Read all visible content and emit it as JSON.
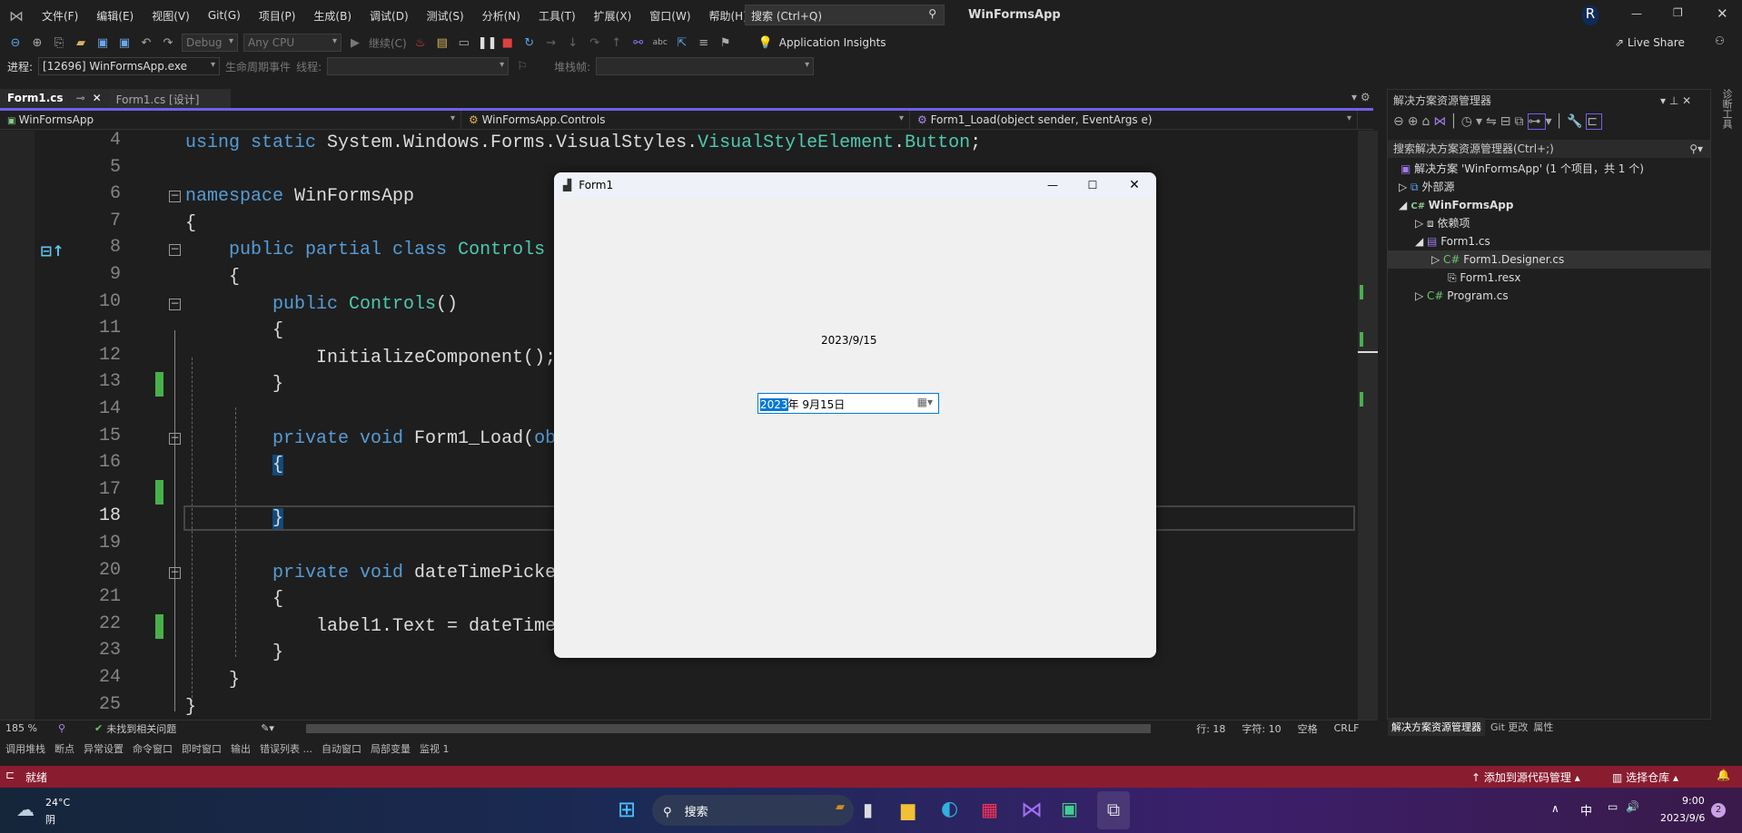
{
  "menu": {
    "items": [
      "文件(F)",
      "编辑(E)",
      "视图(V)",
      "Git(G)",
      "项目(P)",
      "生成(B)",
      "调试(D)",
      "测试(S)",
      "分析(N)",
      "工具(T)",
      "扩展(X)",
      "窗口(W)",
      "帮助(H)"
    ],
    "search": "搜索 (Ctrl+Q)",
    "solution_title": "WinFormsApp",
    "avatar": "R"
  },
  "toolbar": {
    "config": "Debug",
    "platform": "Any CPU",
    "continue": "继续(C)",
    "app_insights": "Application Insights",
    "live_share": "Live Share"
  },
  "toolbar2": {
    "process_label": "进程:",
    "process": "[12696] WinFormsApp.exe",
    "lifecycle": "生命周期事件",
    "thread_label": "线程:",
    "stack_label": "堆栈帧:"
  },
  "tabs": [
    {
      "label": "Form1.cs"
    },
    {
      "label": "Form1.cs [设计]"
    }
  ],
  "nav": {
    "project": "WinFormsApp",
    "class": "WinFormsApp.Controls",
    "member": "Form1_Load(object sender, EventArgs e)"
  },
  "code": {
    "current_line": 18,
    "lines": [
      {
        "n": 4,
        "t": [
          [
            "using ",
            "kw"
          ],
          [
            "static ",
            "kw"
          ],
          [
            "System.Windows.Forms.VisualStyles.",
            "pl"
          ],
          [
            "VisualStyleElement",
            "ty"
          ],
          [
            ".",
            "pl"
          ],
          [
            "Button",
            "ty"
          ],
          [
            ";",
            "pl"
          ]
        ]
      },
      {
        "n": 5,
        "t": []
      },
      {
        "n": 6,
        "t": [
          [
            "namespace ",
            "kw"
          ],
          [
            "WinFormsApp",
            "pl"
          ]
        ]
      },
      {
        "n": 7,
        "t": [
          [
            "{",
            "pl"
          ]
        ]
      },
      {
        "n": 8,
        "t": [
          [
            "    public ",
            "kw"
          ],
          [
            "partial ",
            "kw"
          ],
          [
            "class ",
            "kw"
          ],
          [
            "Controls",
            "ty"
          ]
        ]
      },
      {
        "n": 9,
        "t": [
          [
            "    {",
            "pl"
          ]
        ]
      },
      {
        "n": 10,
        "t": [
          [
            "        public ",
            "kw"
          ],
          [
            "Controls",
            "ty"
          ],
          [
            "()",
            "pl"
          ]
        ]
      },
      {
        "n": 11,
        "t": [
          [
            "        {",
            "pl"
          ]
        ]
      },
      {
        "n": 12,
        "t": [
          [
            "            InitializeComponent();",
            "pl"
          ]
        ]
      },
      {
        "n": 13,
        "t": [
          [
            "        }",
            "pl"
          ]
        ]
      },
      {
        "n": 14,
        "t": []
      },
      {
        "n": 15,
        "t": [
          [
            "        private ",
            "kw"
          ],
          [
            "void ",
            "kw"
          ],
          [
            "Form1_Load(",
            "pl"
          ],
          [
            "ob",
            "kw"
          ]
        ]
      },
      {
        "n": 16,
        "t": [
          [
            "        ",
            "pl"
          ],
          [
            "{",
            "hl"
          ]
        ]
      },
      {
        "n": 17,
        "t": []
      },
      {
        "n": 18,
        "t": [
          [
            "        ",
            "pl"
          ],
          [
            "}",
            "hl"
          ]
        ]
      },
      {
        "n": 19,
        "t": []
      },
      {
        "n": 20,
        "t": [
          [
            "        private ",
            "kw"
          ],
          [
            "void ",
            "kw"
          ],
          [
            "dateTimePicke",
            "pl"
          ]
        ]
      },
      {
        "n": 21,
        "t": [
          [
            "        {",
            "pl"
          ]
        ]
      },
      {
        "n": 22,
        "t": [
          [
            "            label1.Text = dateTime",
            "pl"
          ]
        ]
      },
      {
        "n": 23,
        "t": [
          [
            "        }",
            "pl"
          ]
        ]
      },
      {
        "n": 24,
        "t": [
          [
            "    }",
            "pl"
          ]
        ]
      },
      {
        "n": 25,
        "t": [
          [
            "}",
            "pl"
          ]
        ]
      }
    ]
  },
  "editor_status": {
    "zoom": "185 %",
    "issues": "未找到相关问题",
    "line": "行: 18",
    "char": "字符: 10",
    "spaces": "空格",
    "eol": "CRLF"
  },
  "solution_explorer": {
    "title": "解决方案资源管理器",
    "search": "搜索解决方案资源管理器(Ctrl+;)",
    "solution": "解决方案 'WinFormsApp' (1 个项目，共 1 个)",
    "items": [
      "外部源",
      "WinFormsApp",
      "依赖项",
      "Form1.cs",
      "Form1.Designer.cs",
      "Form1.resx",
      "Program.cs"
    ],
    "bottom_tabs": [
      "解决方案资源管理器",
      "Git 更改",
      "属性"
    ],
    "side_tab": "诊断工具"
  },
  "bottom_tabs": [
    "调用堆栈",
    "断点",
    "异常设置",
    "命令窗口",
    "即时窗口",
    "输出",
    "错误列表 ...",
    "自动窗口",
    "局部变量",
    "监视 1"
  ],
  "statusbar": {
    "ready": "就绪",
    "add_source": "添加到源代码管理",
    "select_repo": "选择仓库"
  },
  "form": {
    "title": "Form1",
    "label": "2023/9/15",
    "picker_year": "2023",
    "picker_rest": "年  9月15日"
  },
  "taskbar": {
    "temp": "24°C",
    "weather": "阴",
    "search": "搜索",
    "ime": "中",
    "time": "9:00",
    "date": "2023/9/6",
    "badge": "2"
  },
  "colors": {
    "accent": "#7160e8",
    "statusbar": "#8a1c30",
    "keyword": "#569cd6",
    "type": "#4ec9b0",
    "change_marker": "#48b04b"
  }
}
